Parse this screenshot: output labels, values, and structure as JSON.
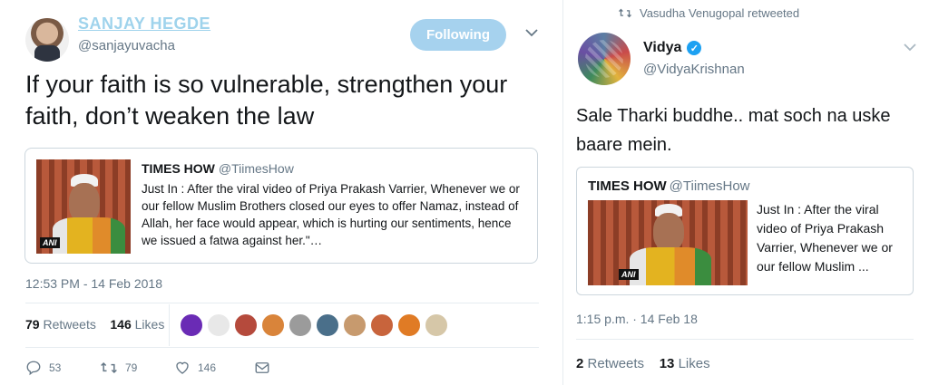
{
  "left_tweet": {
    "author_name": "SANJAY HEGDE",
    "author_handle": "@sanjayuvacha",
    "follow_label": "Following",
    "text": "If your faith is so vulnerable, strengthen your faith, don’t weaken the law",
    "quote": {
      "name": "TIMES HOW",
      "handle": "@TiimesHow",
      "text": "Just In : After the viral video of Priya Prakash Varrier, Whenever we or our fellow Muslim Brothers closed our eyes to offer Namaz, instead of Allah, her face would appear, which is hurting our sentiments, hence we issued a fatwa against her.\"…",
      "thumb_logo": "ANI"
    },
    "timestamp": "12:53 PM - 14 Feb 2018",
    "retweets_count": "79",
    "retweets_label": "Retweets",
    "likes_count": "146",
    "likes_label": "Likes",
    "actions": {
      "reply_count": "53",
      "retweet_count": "79",
      "like_count": "146"
    },
    "liker_colors": [
      "#6a2bb5",
      "#e8e8e8",
      "#b54a3c",
      "#d9843a",
      "#9b9b9b",
      "#4a6f8a",
      "#c79a6e",
      "#c8643c",
      "#e07b25",
      "#d6c7a8"
    ]
  },
  "right_tweet": {
    "retweeted_by": "Vasudha Venugopal retweeted",
    "author_name": "Vidya",
    "author_handle": "@VidyaKrishnan",
    "text": "Sale Tharki buddhe.. mat soch na uske baare mein.",
    "quote": {
      "name": "TIMES HOW",
      "handle": "@TiimesHow",
      "text": "Just In : After the viral video of Priya Prakash Varrier, Whenever we or our fellow Muslim ...",
      "thumb_logo": "ANI"
    },
    "timestamp": "1:15 p.m. · 14 Feb 18",
    "retweets_count": "2",
    "retweets_label": "Retweets",
    "likes_count": "13",
    "likes_label": "Likes"
  },
  "colors": {
    "accent": "#1da1f2",
    "follow_button": "#a6d2ee",
    "name_link": "#9fd3ec",
    "muted": "#657786",
    "border": "#ccd6dd"
  }
}
